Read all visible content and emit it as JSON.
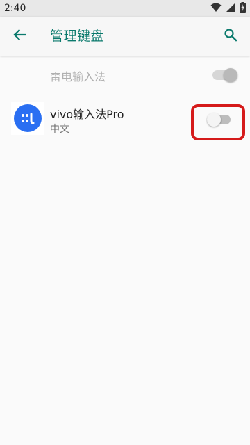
{
  "status_bar": {
    "time": "2:40",
    "icons": [
      "wifi-icon",
      "signal-icon",
      "battery-charging-icon"
    ]
  },
  "app_bar": {
    "title": "管理键盘",
    "back_icon": "arrow-back-icon",
    "search_icon": "search-icon"
  },
  "keyboards": [
    {
      "name": "雷电输入法",
      "enabled": true,
      "disabled_row": true
    },
    {
      "name": "vivo输入法Pro",
      "language": "中文",
      "enabled": false,
      "icon": "vivo-ime-logo-icon"
    }
  ],
  "colors": {
    "accent": "#0b7a6d",
    "highlight": "#d51a1a",
    "ime_logo": "#2a6ff2"
  }
}
